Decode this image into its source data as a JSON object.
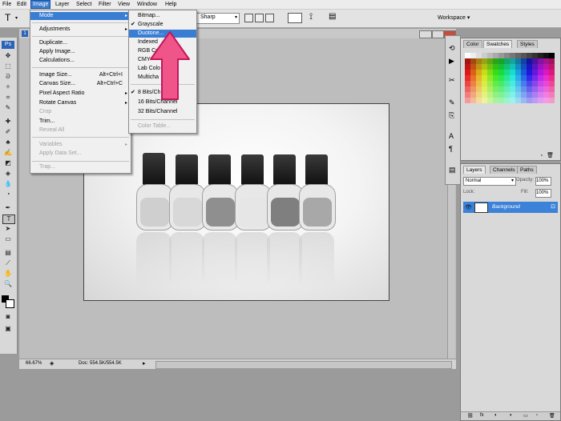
{
  "menubar": {
    "items": [
      "File",
      "Edit",
      "Image",
      "Layer",
      "Select",
      "Filter",
      "View",
      "Window",
      "Help"
    ]
  },
  "options": {
    "font_size": "Sharp",
    "workspace": "Workspace ▾",
    "tool_letter": "T"
  },
  "image_menu": {
    "mode": "Mode",
    "adjustments": "Adjustments",
    "duplicate": "Duplicate...",
    "apply_image": "Apply Image...",
    "calculations": "Calculations...",
    "image_size": "Image Size...",
    "image_size_sc": "Alt+Ctrl+I",
    "canvas_size": "Canvas Size...",
    "canvas_size_sc": "Alt+Ctrl+C",
    "pixel_aspect": "Pixel Aspect Ratio",
    "rotate": "Rotate Canvas",
    "crop": "Crop",
    "trim": "Trim...",
    "reveal": "Reveal All",
    "variables": "Variables",
    "apply_data": "Apply Data Set...",
    "trap": "Trap..."
  },
  "mode_menu": {
    "bitmap": "Bitmap...",
    "grayscale": "Grayscale",
    "duotone": "Duotone...",
    "indexed": "Indexed",
    "rgb": "RGB Co",
    "cmyk": "CMY",
    "lab": "Lab Colo",
    "multi": "Multicha",
    "bits8": "8 Bits/Ch",
    "bits16": "16 Bits/Channel",
    "bits32": "32 Bits/Channel",
    "color_table": "Color Table..."
  },
  "panels": {
    "color_tabs": [
      "Color",
      "Swatches",
      "Styles"
    ],
    "layer_tabs": [
      "Layers",
      "Channels",
      "Paths"
    ],
    "blend_mode": "Normal",
    "opacity_label": "Opacity:",
    "opacity": "100%",
    "lock_label": "Lock:",
    "fill_label": "Fill:",
    "fill": "100%",
    "layer_name": "Background"
  },
  "status": {
    "zoom": "66.67%",
    "doc": "Doc: 554.5K/554.5K"
  },
  "colors": {
    "accent": "#3a7ed3",
    "arrow": "#f0558a"
  }
}
